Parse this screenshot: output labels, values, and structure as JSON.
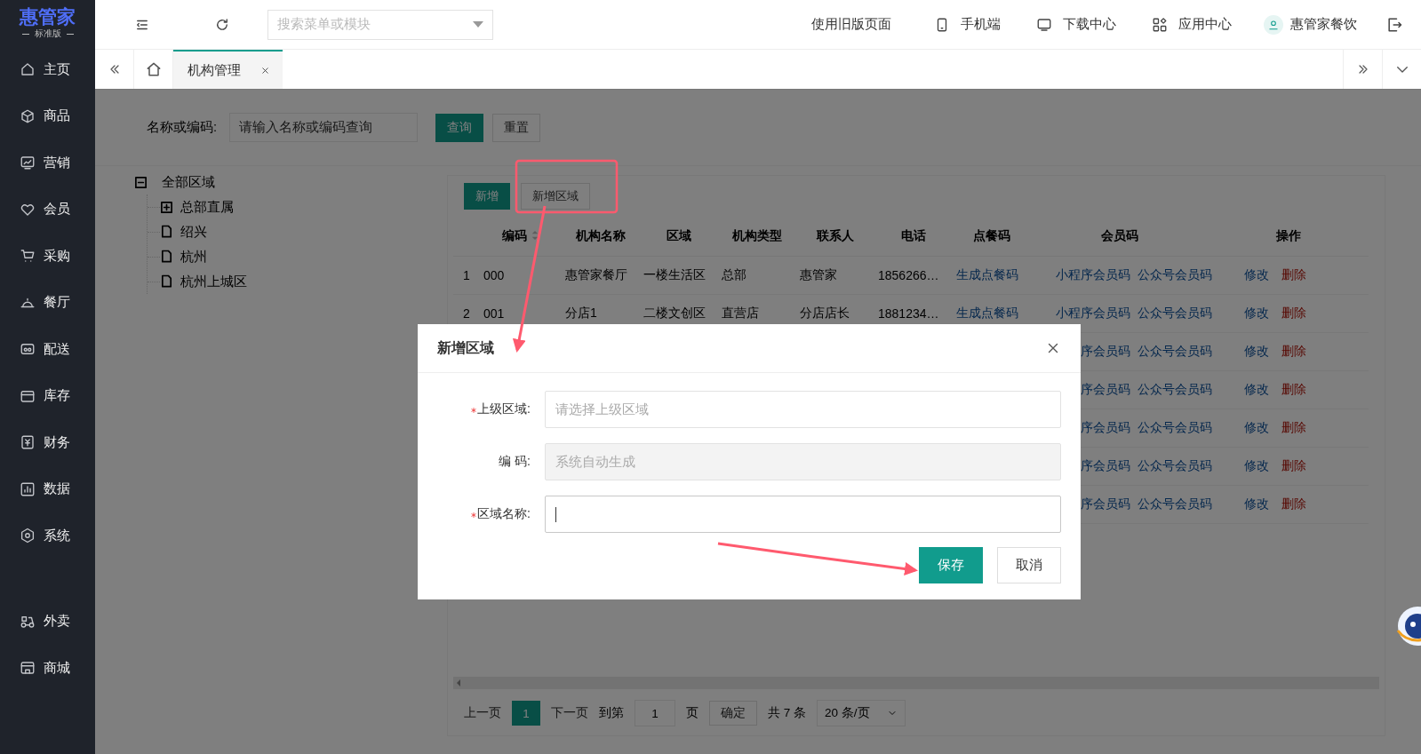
{
  "logo": {
    "name": "惠管家",
    "edition": "标准版"
  },
  "sidebar": {
    "items": [
      {
        "label": "主页",
        "selected": false
      },
      {
        "label": "商品",
        "selected": false
      },
      {
        "label": "营销",
        "selected": false
      },
      {
        "label": "会员",
        "selected": false
      },
      {
        "label": "采购",
        "selected": false
      },
      {
        "label": "餐厅",
        "selected": false
      },
      {
        "label": "配送",
        "selected": false
      },
      {
        "label": "库存",
        "selected": false
      },
      {
        "label": "财务",
        "selected": false
      },
      {
        "label": "数据",
        "selected": false
      },
      {
        "label": "系统",
        "selected": false
      }
    ],
    "bottom_items": [
      {
        "label": "外卖",
        "selected": false
      },
      {
        "label": "商城",
        "selected": false
      }
    ]
  },
  "header": {
    "search": {
      "placeholder": "搜索菜单或模块"
    },
    "old_version": "使用旧版页面",
    "mobile": "手机端",
    "downloads": "下载中心",
    "apps": "应用中心",
    "user": "惠管家餐饮"
  },
  "tabs": [
    {
      "label": "机构管理",
      "selected": true
    }
  ],
  "filter": {
    "label": "名称或编码:",
    "placeholder": "请输入名称或编码查询",
    "query_button": "查询",
    "reset_button": "重置"
  },
  "tree": [
    {
      "label": "全部区域",
      "kind": "folder",
      "expanded": true,
      "children": [
        {
          "label": "总部直属",
          "kind": "folder",
          "expanded": false
        },
        {
          "label": "绍兴",
          "kind": "leaf"
        },
        {
          "label": "杭州",
          "kind": "leaf"
        },
        {
          "label": "杭州上城区",
          "kind": "leaf"
        }
      ]
    }
  ],
  "toolbar": {
    "add_button": "新增",
    "add_area_button": "新增区域"
  },
  "table": {
    "columns": [
      "编码",
      "机构名称",
      "区域",
      "机构类型",
      "联系人",
      "电话",
      "点餐码",
      "会员码",
      "操作"
    ],
    "rows": [
      {
        "index": "1",
        "code": "000",
        "name": "惠管家餐厅",
        "area": "一楼生活区",
        "type": "总部",
        "contact": "惠管家",
        "phone": "1856266…",
        "order_code": "生成点餐码",
        "mini_code": "小程序会员码",
        "official_code": "公众号会员码",
        "edit": "修改",
        "delete": "删除"
      },
      {
        "index": "2",
        "code": "001",
        "name": "分店1",
        "area": "二楼文创区",
        "type": "直营店",
        "contact": "分店店长",
        "phone": "1881234…",
        "order_code": "生成点餐码",
        "mini_code": "小程序会员码",
        "official_code": "公众号会员码",
        "edit": "修改",
        "delete": "删除"
      },
      {
        "mini_code": "序会员码",
        "official_code": "公众号会员码",
        "edit": "修改",
        "delete": "删除"
      },
      {
        "mini_code": "序会员码",
        "official_code": "公众号会员码",
        "edit": "修改",
        "delete": "删除"
      },
      {
        "mini_code": "序会员码",
        "official_code": "公众号会员码",
        "edit": "修改",
        "delete": "删除"
      },
      {
        "mini_code": "序会员码",
        "official_code": "公众号会员码",
        "edit": "修改",
        "delete": "删除"
      },
      {
        "mini_code": "序会员码",
        "official_code": "公众号会员码",
        "edit": "修改",
        "delete": "删除"
      }
    ]
  },
  "pagination": {
    "prev": "上一页",
    "pages": [
      {
        "label": "1",
        "selected": true
      }
    ],
    "next": "下一页",
    "goto_label": "到第",
    "goto_value": "1",
    "page_unit": "页",
    "confirm": "确定",
    "total": "共 7 条",
    "page_size": "20 条/页"
  },
  "dialog": {
    "title": "新增区域",
    "fields": [
      {
        "label": "上级区域:",
        "required": true,
        "placeholder": "请选择上级区域",
        "disabled": false
      },
      {
        "label": "编 码:",
        "required": false,
        "placeholder": "系统自动生成",
        "disabled": true
      },
      {
        "label": "区域名称:",
        "required": true,
        "disabled": false,
        "focused": true
      }
    ],
    "save_button": "保存",
    "cancel_button": "取消"
  }
}
